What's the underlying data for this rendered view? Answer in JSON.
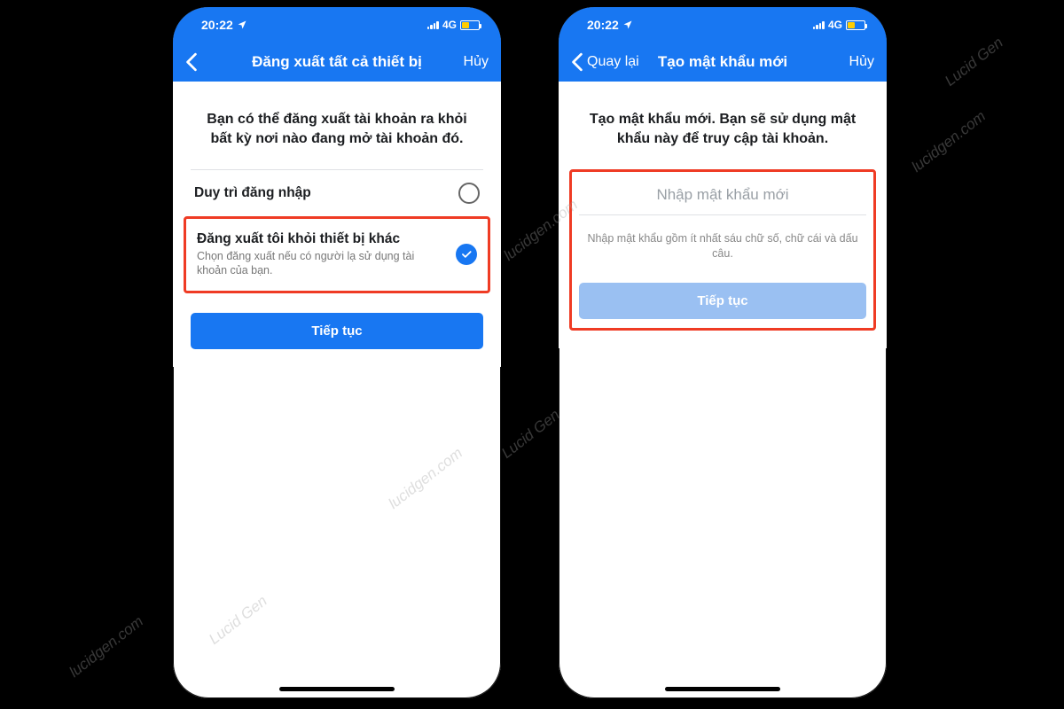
{
  "status": {
    "time": "20:22",
    "network": "4G"
  },
  "screen1": {
    "nav": {
      "title": "Đăng xuất tất cả thiết bị",
      "cancel": "Hủy"
    },
    "heading": "Bạn có thể đăng xuất tài khoản ra khỏi bất kỳ nơi nào đang mở tài khoản đó.",
    "option1": {
      "title": "Duy trì đăng nhập"
    },
    "option2": {
      "title": "Đăng xuất tôi khỏi thiết bị khác",
      "sub": "Chọn đăng xuất nếu có người lạ sử dụng tài khoản của bạn."
    },
    "continue": "Tiếp tục"
  },
  "screen2": {
    "nav": {
      "back": "Quay lại",
      "title": "Tạo mật khẩu mới",
      "cancel": "Hủy"
    },
    "heading": "Tạo mật khẩu mới. Bạn sẽ sử dụng mật khẩu này để truy cập tài khoản.",
    "placeholder": "Nhập mật khẩu mới",
    "help": "Nhập mật khẩu gồm ít nhất sáu chữ số, chữ cái và dấu câu.",
    "continue": "Tiếp tục"
  },
  "watermark": {
    "brand": "Lucid Gen",
    "site": "lucidgen.com"
  }
}
